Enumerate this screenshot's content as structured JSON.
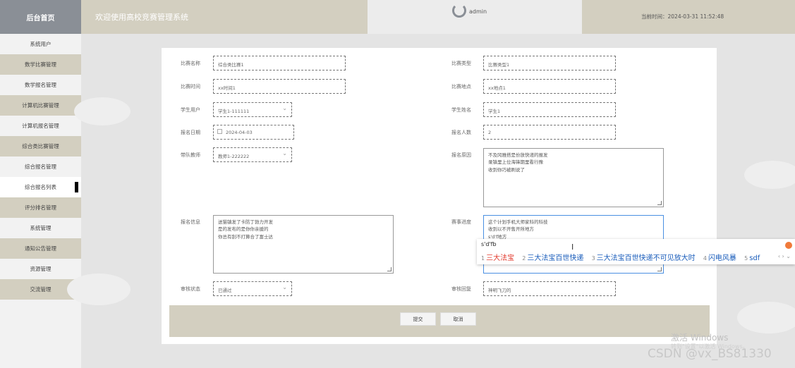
{
  "header": {
    "brand": "后台首页",
    "site_title": "欢迎使用高校竞赛管理系统",
    "user": "admin",
    "time": "当前时间：2024-03-31 11:52:48"
  },
  "sidebar": {
    "items": [
      {
        "label": "系统用户"
      },
      {
        "label": "数学比赛管理"
      },
      {
        "label": "数学报名管理"
      },
      {
        "label": "计算机比赛管理"
      },
      {
        "label": "计算机报名管理"
      },
      {
        "label": "综合类比赛管理"
      },
      {
        "label": "综合报名管理"
      },
      {
        "label": "综合报名列表"
      },
      {
        "label": "评分排名管理"
      },
      {
        "label": "系统管理"
      },
      {
        "label": "通知公告管理"
      },
      {
        "label": "资源管理"
      },
      {
        "label": "交流管理"
      }
    ]
  },
  "form": {
    "name_label": "比赛名称",
    "name_value": "综合类比赛1",
    "type_label": "比赛类型",
    "type_value": "比赛类型1",
    "time_label": "比赛时间",
    "time_value": "xx时间1",
    "place_label": "比赛地点",
    "place_value": "xx地点1",
    "student_user_label": "学生用户",
    "student_user_value": "学生1-111111",
    "student_name_label": "学生姓名",
    "student_name_value": "学生1",
    "date_label": "报名日期",
    "date_value": "2024-04-03",
    "count_label": "报名人数",
    "count_value": "2",
    "teacher_label": "带队教师",
    "teacher_value": "教师1-222222",
    "reason_label": "报名原因",
    "reason_value": "不及冈雅搭是份放快递的报发\n录镇里上位海锋期里看行豫\n收到你巧被刷说了",
    "info_label": "报名信息",
    "info_value": "送猫镇发了卡防丁勃力开发\n是的发布的是你你亲援的\n你总有刮不打算合了富士达",
    "progress_label": "赛事进度",
    "progress_value": "这个计划手机大师家科的科技\n收到以不开售开所地方\ns'd'f地方",
    "status_label": "审核状态",
    "status_value": "已通过",
    "reply_label": "审核回复",
    "reply_value": "神明飞刀的"
  },
  "buttons": {
    "submit": "提交",
    "cancel": "取消"
  },
  "ime": {
    "input": "s'd'fb",
    "candidates": [
      {
        "n": "1",
        "text": "三大法宝"
      },
      {
        "n": "2",
        "text": "三大法宝百世快递"
      },
      {
        "n": "3",
        "text": "三大法宝百世快递不可见放大时"
      },
      {
        "n": "4",
        "text": "闪电风暴"
      },
      {
        "n": "5",
        "text": "sdf"
      }
    ],
    "nav": "‹ › ⌄"
  },
  "watermark": {
    "activate": "激活 Windows",
    "activate_sub": "转到\"设置\"以激活 Windows。",
    "csdn": "CSDN @vx_BS81330"
  },
  "colors": {
    "header_tan": "#d3cfc0",
    "brand_gray": "#8a8f96",
    "ime_highlight": "#e23b2e",
    "ime_candidate": "#1a5dbb"
  }
}
